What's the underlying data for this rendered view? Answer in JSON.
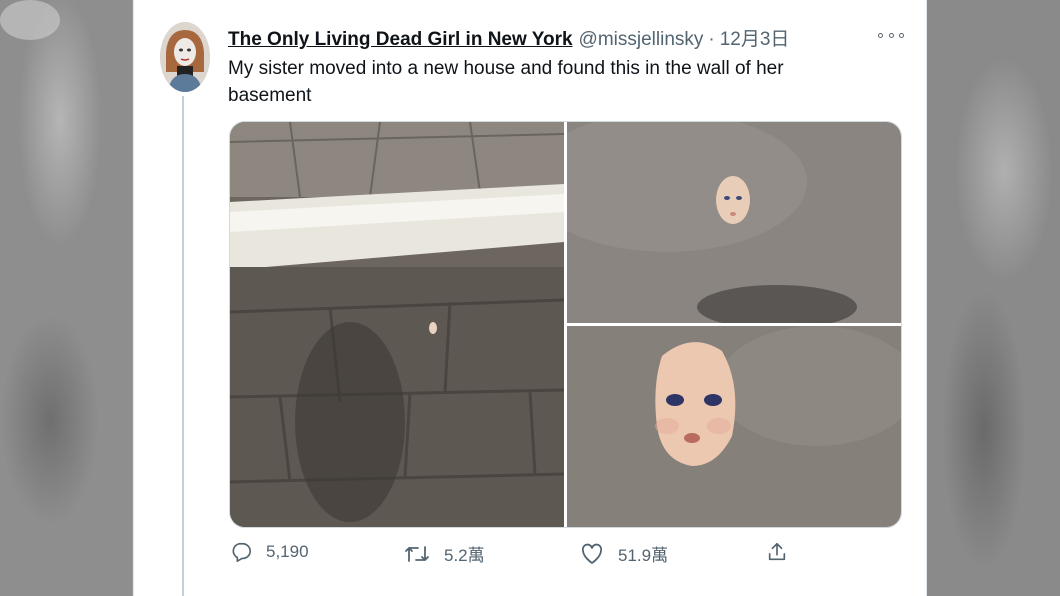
{
  "tweet": {
    "display_name": "The Only Living Dead Girl in New York",
    "handle": "@missjellinsky",
    "separator": "·",
    "timestamp": "12月3日",
    "text": "My sister moved into a new house and found this in the wall of her basement"
  },
  "actions": {
    "replies": "5,190",
    "retweets": "5.2萬",
    "likes": "51.9萬"
  },
  "icons": [
    "more-icon",
    "reply-icon",
    "retweet-icon",
    "like-icon",
    "share-icon"
  ],
  "colors": {
    "text": "#0f1419",
    "secondary": "#536471",
    "thread_line": "#c4cfd6"
  }
}
